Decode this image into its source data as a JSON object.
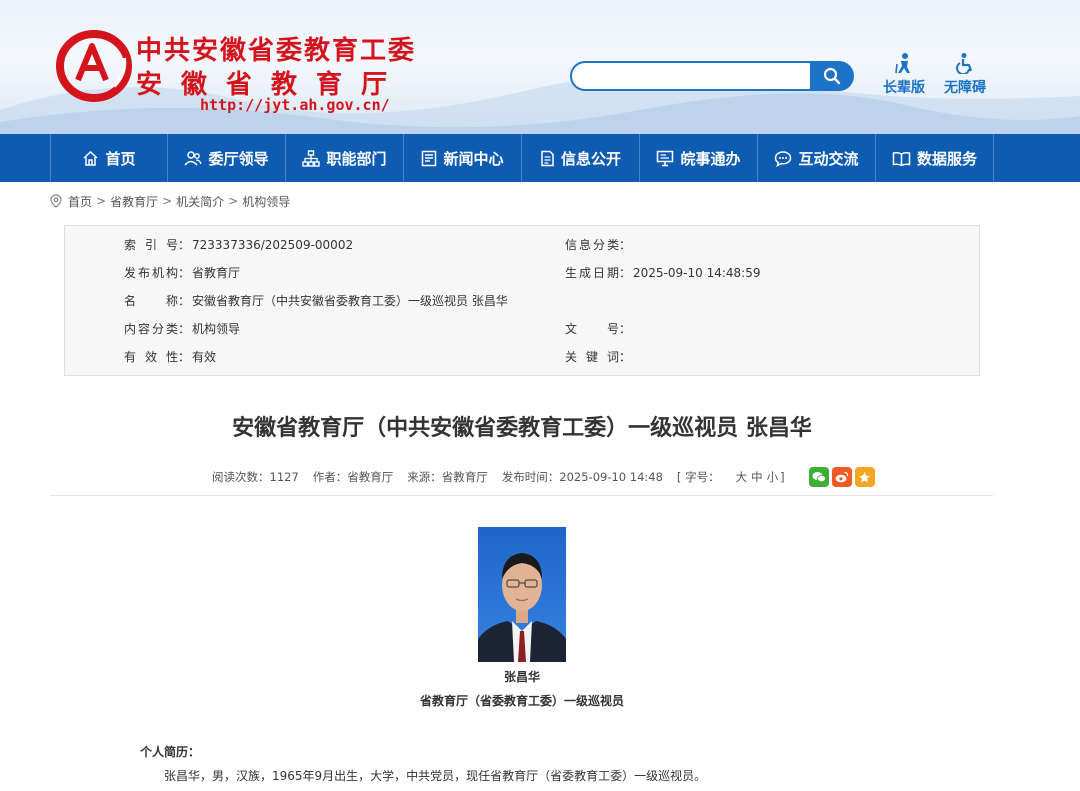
{
  "header": {
    "site_title_cn_1": "中共安徽省委教育工委",
    "site_title_cn_2": "安徽省教育厅",
    "site_url": "http://jyt.ah.gov.cn/",
    "search": {
      "placeholder": ""
    },
    "tools": {
      "elder_label": "长辈版",
      "accessible_label": "无障碍"
    }
  },
  "nav": {
    "items": [
      {
        "label": "首页",
        "icon": "home-icon"
      },
      {
        "label": "委厅领导",
        "icon": "leaders-icon"
      },
      {
        "label": "职能部门",
        "icon": "org-chart-icon"
      },
      {
        "label": "新闻中心",
        "icon": "news-icon"
      },
      {
        "label": "信息公开",
        "icon": "document-icon"
      },
      {
        "label": "皖事通办",
        "icon": "monitor-icon"
      },
      {
        "label": "互动交流",
        "icon": "chat-icon"
      },
      {
        "label": "数据服务",
        "icon": "book-icon"
      }
    ]
  },
  "breadcrumb": {
    "items": [
      "首页",
      "省教育厅",
      "机关简介",
      "机构领导"
    ],
    "separator": ">"
  },
  "info": {
    "index_label": "索引号",
    "index_value": "723337336/202509-00002",
    "category_label": "信息分类",
    "category_value": "",
    "publisher_label": "发布机构",
    "publisher_value": "省教育厅",
    "date_label": "生成日期",
    "date_value": "2025-09-10 14:48:59",
    "name_label": "名称",
    "name_value": "安徽省教育厅（中共安徽省委教育工委）一级巡视员 张昌华",
    "content_label": "内容分类",
    "content_value": "机构领导",
    "docno_label": "文号",
    "docno_value": "",
    "validity_label": "有效性",
    "validity_value": "有效",
    "keywords_label": "关键词",
    "keywords_value": ""
  },
  "article": {
    "title": "安徽省教育厅（中共安徽省委教育工委）一级巡视员 张昌华",
    "meta": {
      "views": "阅读次数：1127",
      "author": "作者：省教育厅",
      "source": "来源：省教育厅",
      "pubtime": "发布时间：2025-09-10 14:48",
      "fontsize_prefix": "[ 字号：",
      "size_large": "大",
      "size_medium": "中",
      "size_small": "小",
      "fontsize_suffix": "]"
    },
    "photo_name": "张昌华",
    "photo_position": "省教育厅（省委教育工委）一级巡视员",
    "resume_title": "个人简历：",
    "resume_text": "张昌华，男，汉族，1965年9月出生，大学，中共党员，现任省教育厅（省委教育工委）一级巡视员。"
  },
  "colors": {
    "brand_red": "#d4141c",
    "nav_blue": "#0e5bb2",
    "accent_blue": "#1d73c7",
    "wechat_green": "#3cb034",
    "weibo_orange": "#ee5a24",
    "favorite_orange": "#f5a623"
  }
}
